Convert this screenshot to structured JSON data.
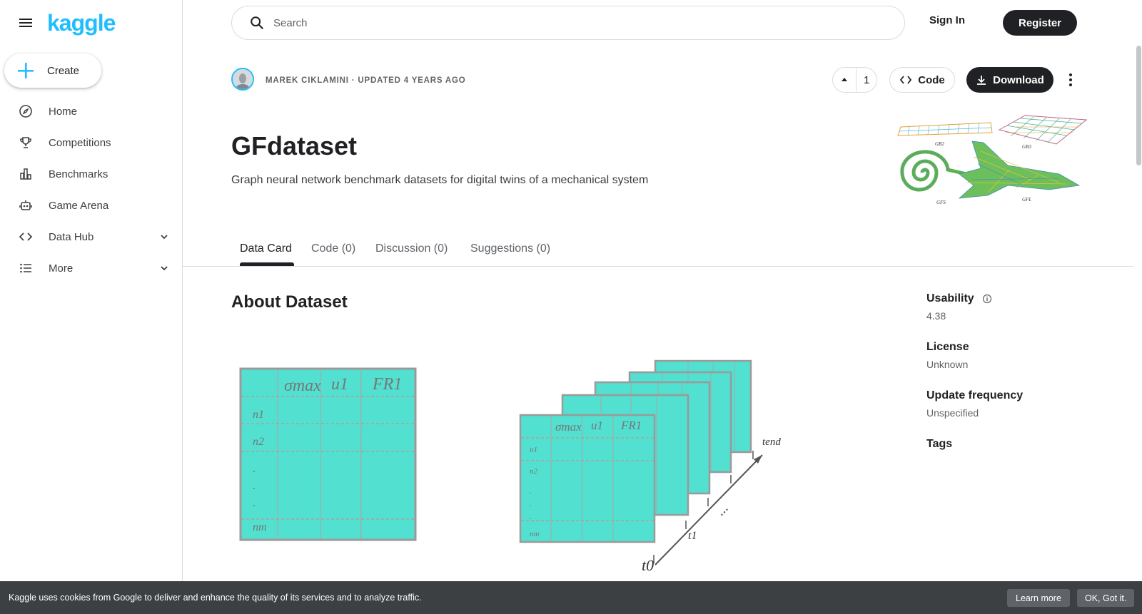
{
  "brand": {
    "logo_text": "kaggle",
    "accent": "#20beff"
  },
  "sidebar": {
    "create_label": "Create",
    "items": [
      {
        "label": "Home",
        "icon": "compass-icon"
      },
      {
        "label": "Competitions",
        "icon": "trophy-icon"
      },
      {
        "label": "Benchmarks",
        "icon": "bar-chart-icon"
      },
      {
        "label": "Game Arena",
        "icon": "robot-icon"
      },
      {
        "label": "Data Hub",
        "icon": "code-brackets-icon",
        "expandable": true
      },
      {
        "label": "More",
        "icon": "list-icon",
        "expandable": true
      }
    ]
  },
  "topbar": {
    "search_placeholder": "Search",
    "signin_label": "Sign In",
    "register_label": "Register"
  },
  "dataset": {
    "byline": "MAREK CIKLAMINI · UPDATED 4 YEARS AGO",
    "vote_count": "1",
    "code_label": "Code",
    "download_label": "Download",
    "title": "GFdataset",
    "subtitle": "Graph neural network benchmark datasets for digital twins of a mechanical system"
  },
  "tabs": [
    {
      "label": "Data Card",
      "active": true
    },
    {
      "label": "Code (0)"
    },
    {
      "label": "Discussion (0)"
    },
    {
      "label": "Suggestions (0)"
    }
  ],
  "content": {
    "about_heading": "About Dataset"
  },
  "figure": {
    "table_headers": [
      "σmax",
      "u1",
      "FR1"
    ],
    "row_labels": [
      "n1",
      "n2",
      ".",
      ".",
      ".",
      "nm"
    ],
    "axis_labels": [
      "t0",
      "t1",
      "tend"
    ],
    "fill_color": "#52e0d0"
  },
  "cover_labels": [
    "GB2",
    "GB3",
    "GFS",
    "GFL"
  ],
  "meta": {
    "usability_label": "Usability",
    "usability_value": "4.38",
    "license_label": "License",
    "license_value": "Unknown",
    "update_label": "Update frequency",
    "update_value": "Unspecified",
    "tags_label": "Tags"
  },
  "cookie": {
    "message": "Kaggle uses cookies from Google to deliver and enhance the quality of its services and to analyze traffic.",
    "learn_label": "Learn more",
    "ok_label": "OK, Got it."
  }
}
